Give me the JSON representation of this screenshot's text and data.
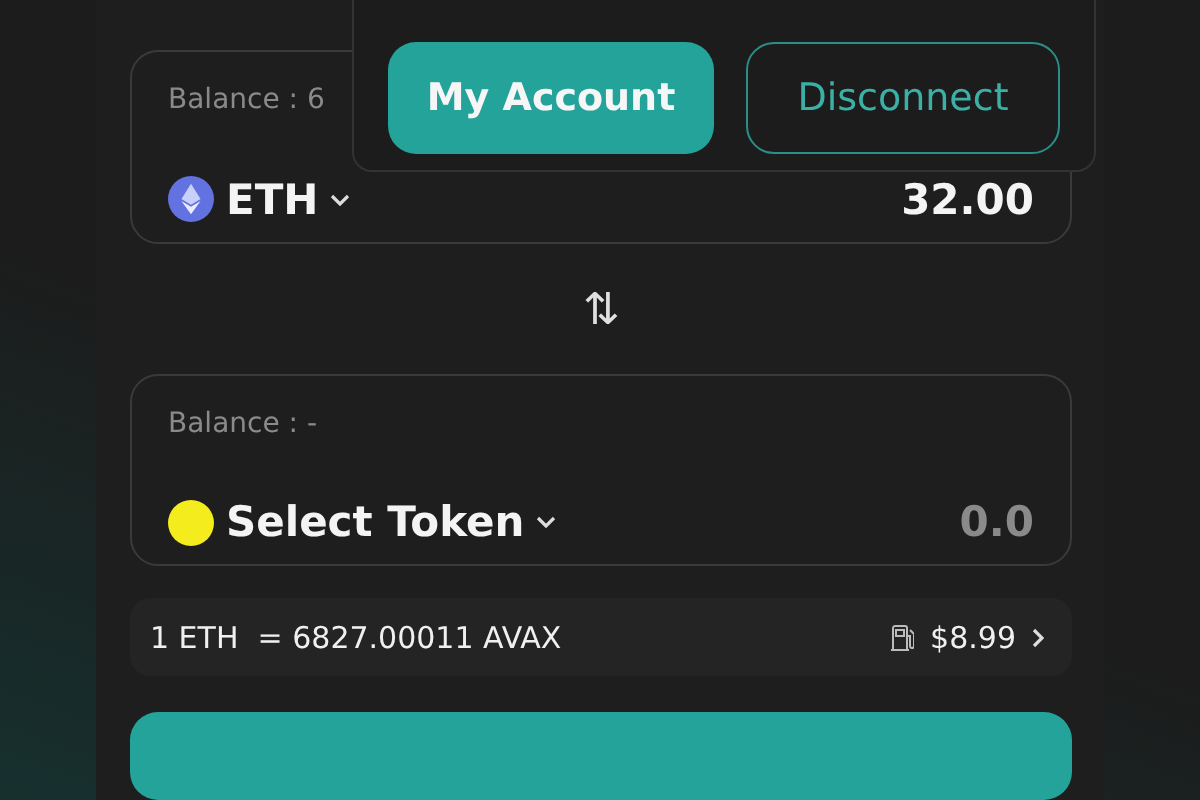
{
  "swap_cards": [
    {
      "balance": "Balance : 6",
      "token": "ETH",
      "kind": "eth",
      "color": "#6272e0",
      "amount": "32.00",
      "amount_placeholder": false
    },
    {
      "balance": "Balance : -",
      "token": "Select Token",
      "kind": "dot",
      "color": "#f5ec1e",
      "amount": "0.0",
      "amount_placeholder": true
    }
  ],
  "swap_icon": "⇅",
  "rate": {
    "text": "1 ETH  = 6827.00011 AVAX",
    "gas": "$8.99"
  },
  "account_menu": {
    "buttons": [
      {
        "label": "My Account",
        "kind": "primary"
      },
      {
        "label": "Disconnect",
        "kind": "outline"
      }
    ]
  }
}
